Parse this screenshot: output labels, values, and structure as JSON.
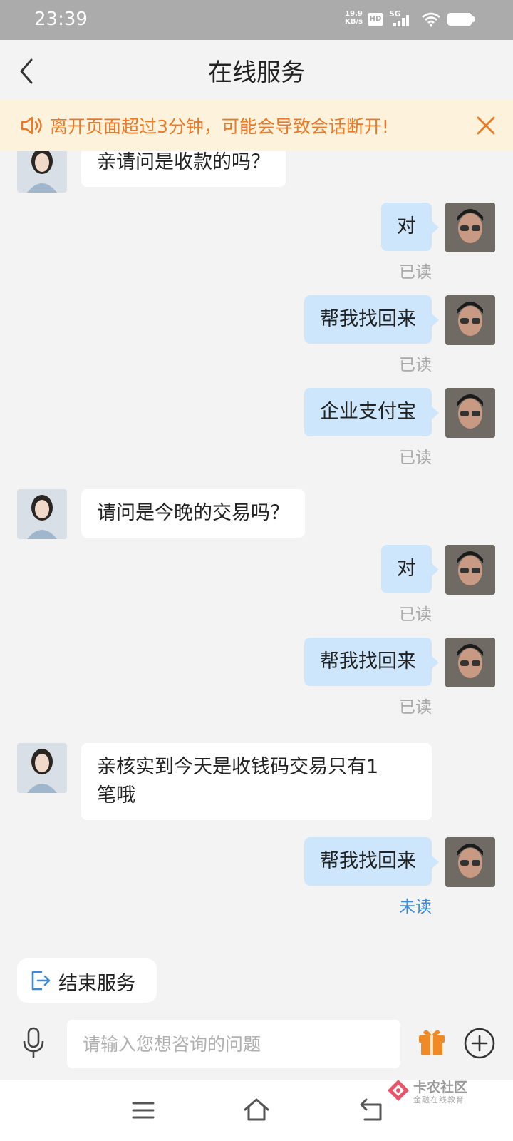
{
  "status_bar": {
    "time": "23:39",
    "net_speed_value": "19.9",
    "net_speed_unit": "KB/s",
    "hd_label": "HD",
    "network_label": "5G"
  },
  "header": {
    "title": "在线服务",
    "back_icon": "chevron-left-icon"
  },
  "notice": {
    "text": "离开页面超过3分钟，可能会导致会话断开!",
    "icon": "speaker-icon",
    "close_icon": "close-icon",
    "color": "#ec7826",
    "background": "#fdf3dd"
  },
  "messages": [
    {
      "from": "agent",
      "text": "亲请问是收款的吗？"
    },
    {
      "from": "user",
      "text": "对",
      "status": "已读"
    },
    {
      "from": "user",
      "text": "帮我找回来",
      "status": "已读"
    },
    {
      "from": "user",
      "text": "企业支付宝",
      "status": "已读"
    },
    {
      "from": "agent",
      "text": "请问是今晚的交易吗？"
    },
    {
      "from": "user",
      "text": "对",
      "status": "已读"
    },
    {
      "from": "user",
      "text": "帮我找回来",
      "status": "已读"
    },
    {
      "from": "agent",
      "lines": [
        "亲核实到今天是收钱码交易只有1",
        "笔哦"
      ]
    },
    {
      "from": "user",
      "text": "帮我找回来",
      "status": "未读"
    }
  ],
  "end_service": {
    "label": "结束服务",
    "icon": "exit-icon"
  },
  "input": {
    "placeholder": "请输入您想咨询的问题",
    "mic_icon": "microphone-icon",
    "gift_icon": "gift-icon",
    "plus_icon": "plus-circle-icon"
  },
  "watermark": {
    "title": "卡农社区",
    "subtitle": "金融在线教育"
  },
  "colors": {
    "user_bubble": "#cde6fb",
    "agent_bubble": "#ffffff",
    "unread": "#3b8ad9",
    "gift": "#f08a24"
  }
}
